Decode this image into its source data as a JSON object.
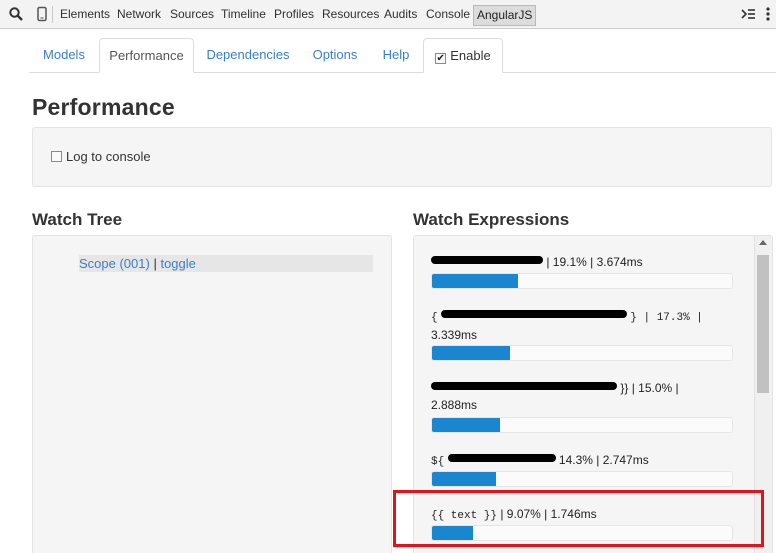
{
  "devtools": {
    "tabs": [
      "Elements",
      "Network",
      "Sources",
      "Timeline",
      "Profiles",
      "Resources",
      "Audits",
      "Console",
      "AngularJS"
    ],
    "active_tab": "AngularJS"
  },
  "nav": {
    "tabs": [
      "Models",
      "Performance",
      "Dependencies",
      "Options",
      "Help"
    ],
    "active_tab": "Performance",
    "enable_label": "Enable",
    "enable_checked": true
  },
  "page": {
    "title": "Performance",
    "log_label": "Log to console",
    "log_checked": false
  },
  "watch_tree": {
    "title": "Watch Tree",
    "scope_label": "Scope (001)",
    "separator": "|",
    "toggle_label": "toggle"
  },
  "watch_expressions": {
    "title": "Watch Expressions",
    "items": [
      {
        "prefix": "",
        "suffix": "| 19.1% | 3.674ms",
        "line2": "",
        "percent": 19.1,
        "redacted": true
      },
      {
        "prefix": "{",
        "suffix": "} | 17.3% |",
        "line2": "3.339ms",
        "percent": 17.3,
        "redacted": true
      },
      {
        "prefix": "",
        "suffix": "}} | 15.0% |",
        "line2": "2.888ms",
        "percent": 15.0,
        "redacted": true
      },
      {
        "prefix": "${",
        "suffix": "14.3% | 2.747ms",
        "line2": "",
        "percent": 14.3,
        "redacted": true
      },
      {
        "prefix": "{{ text }}",
        "suffix": "| 9.07% | 1.746ms",
        "line2": "",
        "percent": 9.07,
        "redacted": false
      }
    ]
  },
  "colors": {
    "bar": "#1a86cf",
    "link": "#3a7fc6",
    "highlight": "#e0141c"
  }
}
